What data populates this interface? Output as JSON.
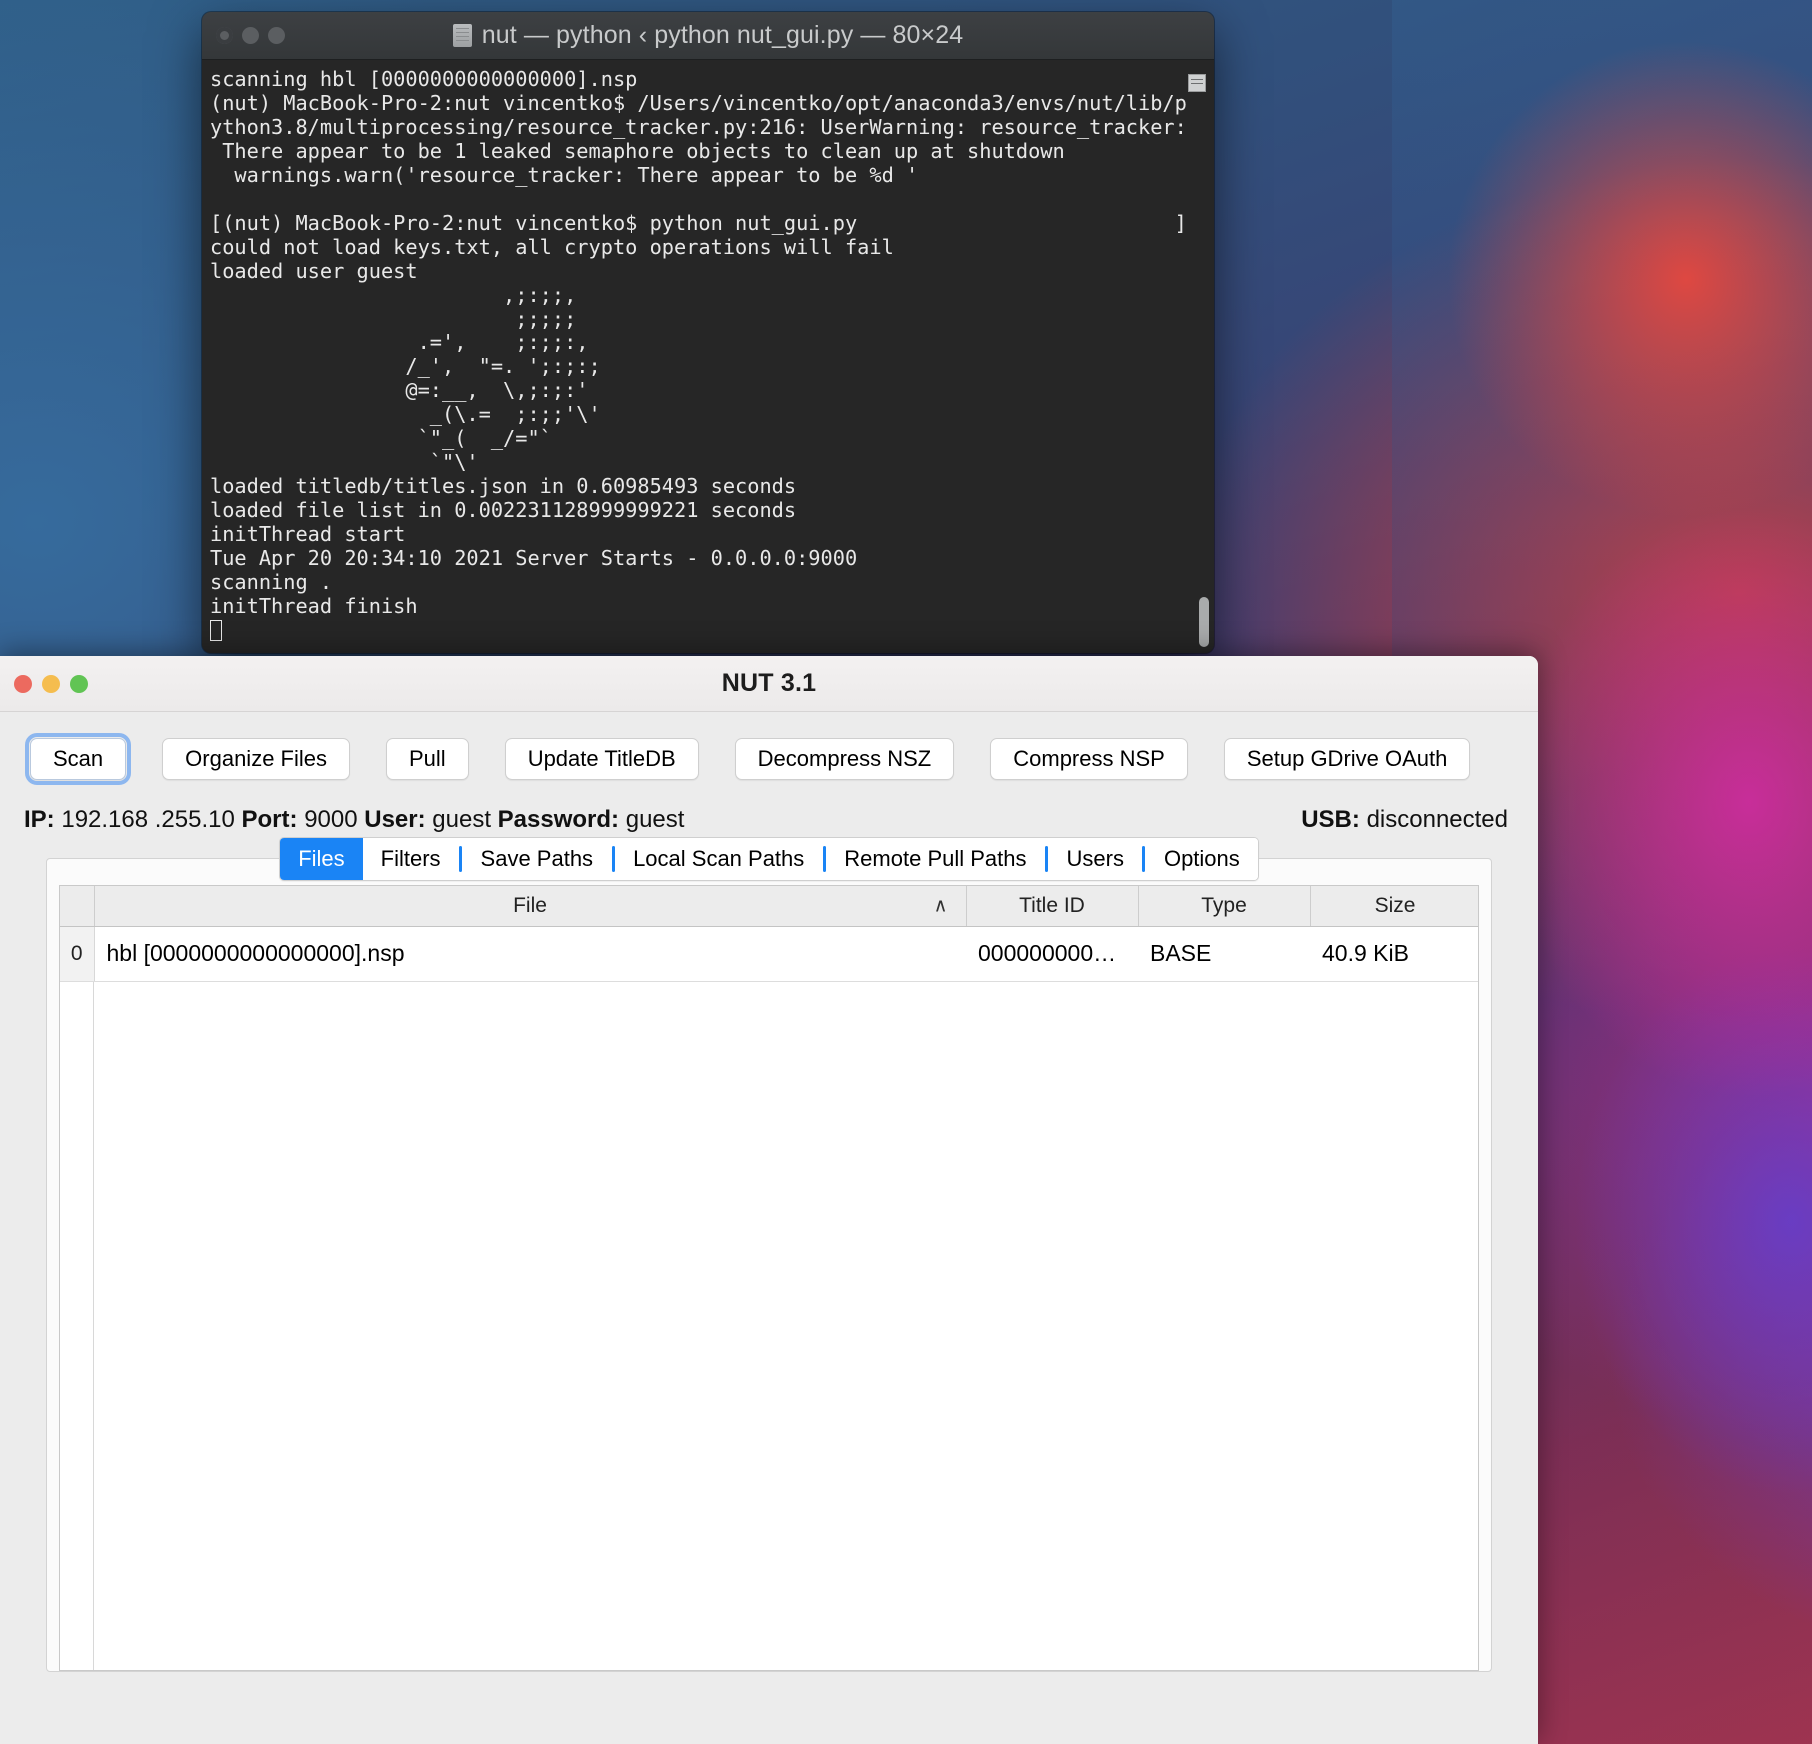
{
  "terminal": {
    "title": "nut — python ‹ python nut_gui.py — 80×24",
    "icon": "document-icon",
    "content": "scanning hbl [0000000000000000].nsp\n(nut) MacBook-Pro-2:nut vincentko$ /Users/vincentko/opt/anaconda3/envs/nut/lib/p\nython3.8/multiprocessing/resource_tracker.py:216: UserWarning: resource_tracker:\n There appear to be 1 leaked semaphore objects to clean up at shutdown\n  warnings.warn('resource_tracker: There appear to be %d '\n\n[(nut) MacBook-Pro-2:nut vincentko$ python nut_gui.py                          ]\ncould not load keys.txt, all crypto operations will fail\nloaded user guest\n                        ,;:;;,\n                         ;;;;;\n                 .=',    ;:;;:,\n                /_',  \"=. ';:;:;\n                @=:__,  \\,;:;:'\n                  _(\\.=  ;:;;'\\'\n                 `\"_(  _/=\"`\n                  `\"\\'\nloaded titledb/titles.json in 0.60985493 seconds\nloaded file list in 0.002231128999999221 seconds\ninitThread start\nTue Apr 20 20:34:10 2021 Server Starts - 0.0.0.0:9000\nscanning .\ninitThread finish\n"
  },
  "nut": {
    "title": "NUT 3.1",
    "traffic_lights": [
      "close-button",
      "minimize-button",
      "zoom-button"
    ],
    "toolbar": [
      {
        "label": "Scan",
        "focused": true
      },
      {
        "label": "Organize Files",
        "focused": false
      },
      {
        "label": "Pull",
        "focused": false
      },
      {
        "label": "Update TitleDB",
        "focused": false
      },
      {
        "label": "Decompress NSZ",
        "focused": false
      },
      {
        "label": "Compress NSP",
        "focused": false
      },
      {
        "label": "Setup GDrive OAuth",
        "focused": false
      }
    ],
    "info": {
      "ip_label": "IP:",
      "ip_value": "192.168 .255.10",
      "port_label": "Port:",
      "port_value": "9000",
      "user_label": "User:",
      "user_value": "guest",
      "password_label": "Password:",
      "password_value": "guest",
      "usb_label": "USB:",
      "usb_value": "disconnected"
    },
    "tabs": [
      {
        "label": "Files",
        "active": true
      },
      {
        "label": "Filters",
        "active": false
      },
      {
        "label": "Save Paths",
        "active": false
      },
      {
        "label": "Local Scan Paths",
        "active": false
      },
      {
        "label": "Remote Pull Paths",
        "active": false
      },
      {
        "label": "Users",
        "active": false
      },
      {
        "label": "Options",
        "active": false
      }
    ],
    "table": {
      "columns": [
        "File",
        "Title ID",
        "Type",
        "Size"
      ],
      "sort_indicator": "∧",
      "rows": [
        {
          "index": "0",
          "file": "hbl [0000000000000000].nsp",
          "title_id": "000000000…",
          "type": "BASE",
          "size": "40.9 KiB"
        }
      ]
    }
  },
  "colors": {
    "accent_blue": "#1a84f5",
    "focus_ring": "#8db7ef",
    "window_bg": "#ececec",
    "terminal_bg": "#262626"
  }
}
